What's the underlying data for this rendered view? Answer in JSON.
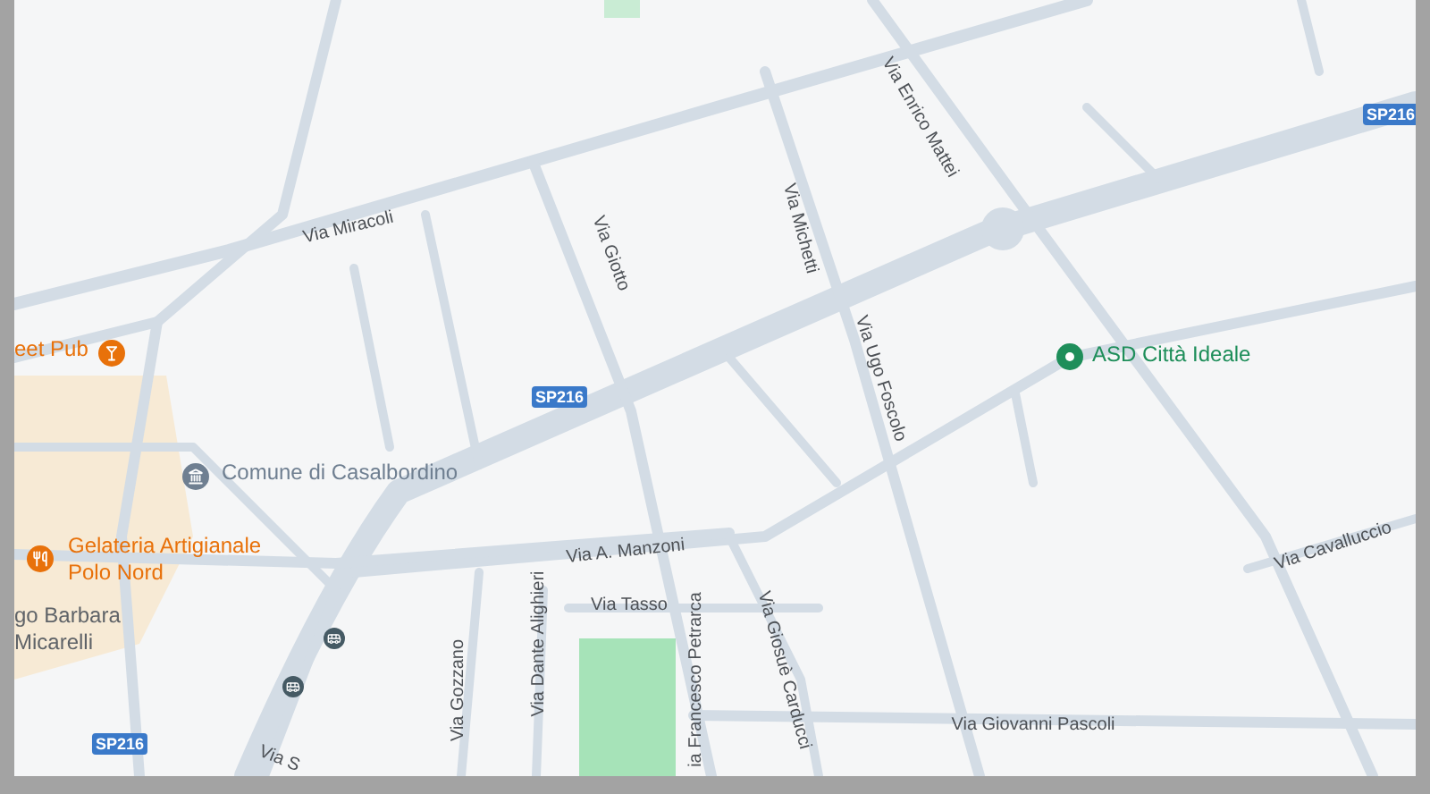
{
  "map": {
    "streets": [
      "Via Miracoli",
      "Via Giotto",
      "Via Michetti",
      "Via Enrico Mattei",
      "Via Ugo Foscolo",
      "Via A. Manzoni",
      "Via Tasso",
      "Via Gozzano",
      "Via Dante Alighieri",
      "ia Francesco Petrarca",
      "Via Giosuè Carducci",
      "Via Giovanni Pascoli",
      "Via Cavalluccio",
      "Via S"
    ],
    "route_shields": [
      "SP216",
      "SP216",
      "SP216"
    ],
    "places": [
      {
        "kind": "bar",
        "lines": [
          "eet Pub"
        ],
        "color": "#e8710a"
      },
      {
        "kind": "town-hall",
        "lines": [
          "Comune di Casalbordino"
        ],
        "color": "#6f7f91"
      },
      {
        "kind": "restaurant",
        "lines": [
          "Gelateria Artigianale",
          "Polo Nord"
        ],
        "color": "#e8710a"
      },
      {
        "kind": "venue",
        "lines": [
          "ASD Città Ideale"
        ],
        "color": "#1e8e5a"
      },
      {
        "kind": "square",
        "lines": [
          "go Barbara",
          "Micarelli"
        ],
        "color": "#5f6368"
      }
    ]
  }
}
